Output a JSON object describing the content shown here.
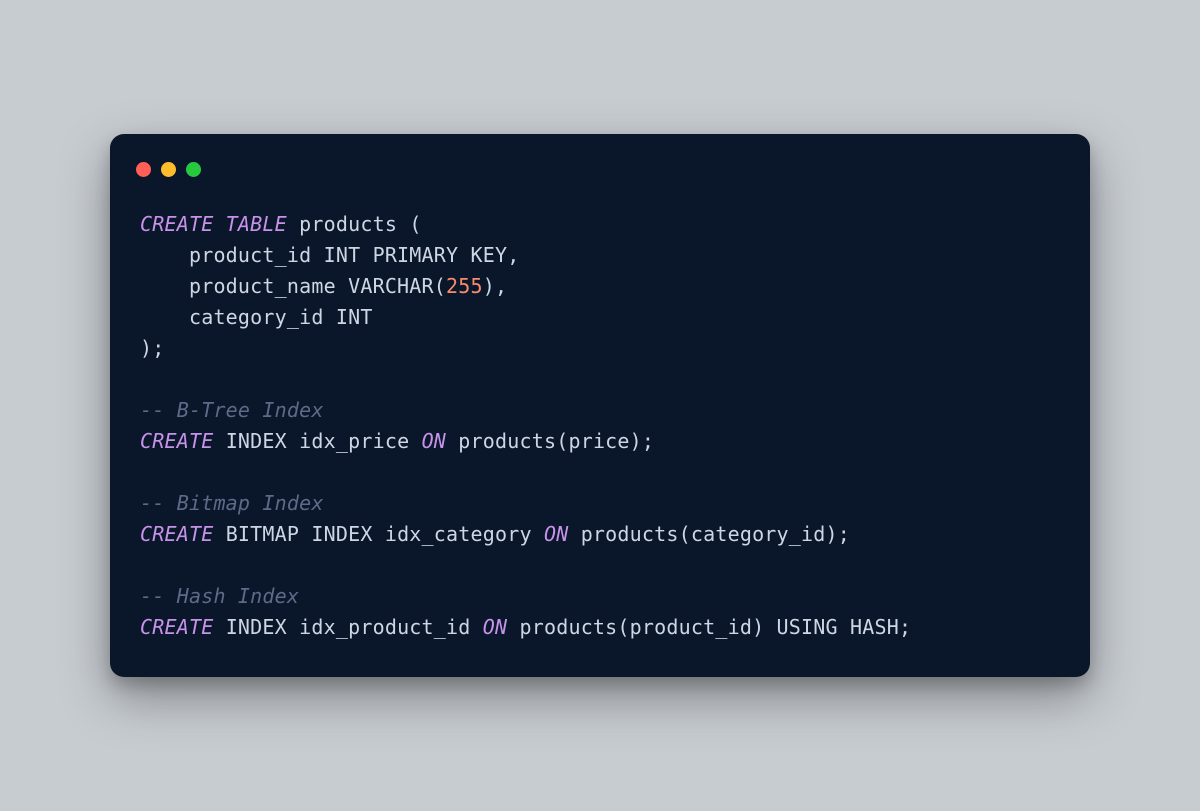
{
  "window": {
    "buttons": [
      "close",
      "minimize",
      "maximize"
    ]
  },
  "code": {
    "lines": [
      [
        {
          "t": "CREATE TABLE",
          "c": "kw"
        },
        {
          "t": " products (",
          "c": "ident"
        }
      ],
      [
        {
          "t": "    product_id INT PRIMARY KEY,",
          "c": "ident"
        }
      ],
      [
        {
          "t": "    product_name VARCHAR(",
          "c": "ident"
        },
        {
          "t": "255",
          "c": "num"
        },
        {
          "t": "),",
          "c": "ident"
        }
      ],
      [
        {
          "t": "    category_id INT",
          "c": "ident"
        }
      ],
      [
        {
          "t": ");",
          "c": "ident"
        }
      ],
      [
        {
          "t": "",
          "c": "ident"
        }
      ],
      [
        {
          "t": "-- B-Tree Index",
          "c": "comment"
        }
      ],
      [
        {
          "t": "CREATE",
          "c": "kw"
        },
        {
          "t": " INDEX idx_price ",
          "c": "ident"
        },
        {
          "t": "ON",
          "c": "kw"
        },
        {
          "t": " products(price);",
          "c": "ident"
        }
      ],
      [
        {
          "t": "",
          "c": "ident"
        }
      ],
      [
        {
          "t": "-- Bitmap Index",
          "c": "comment"
        }
      ],
      [
        {
          "t": "CREATE",
          "c": "kw"
        },
        {
          "t": " BITMAP INDEX idx_category ",
          "c": "ident"
        },
        {
          "t": "ON",
          "c": "kw"
        },
        {
          "t": " products(category_id);",
          "c": "ident"
        }
      ],
      [
        {
          "t": "",
          "c": "ident"
        }
      ],
      [
        {
          "t": "-- Hash Index",
          "c": "comment"
        }
      ],
      [
        {
          "t": "CREATE",
          "c": "kw"
        },
        {
          "t": " INDEX idx_product_id ",
          "c": "ident"
        },
        {
          "t": "ON",
          "c": "kw"
        },
        {
          "t": " products(product_id) USING HASH;",
          "c": "ident"
        }
      ]
    ]
  }
}
